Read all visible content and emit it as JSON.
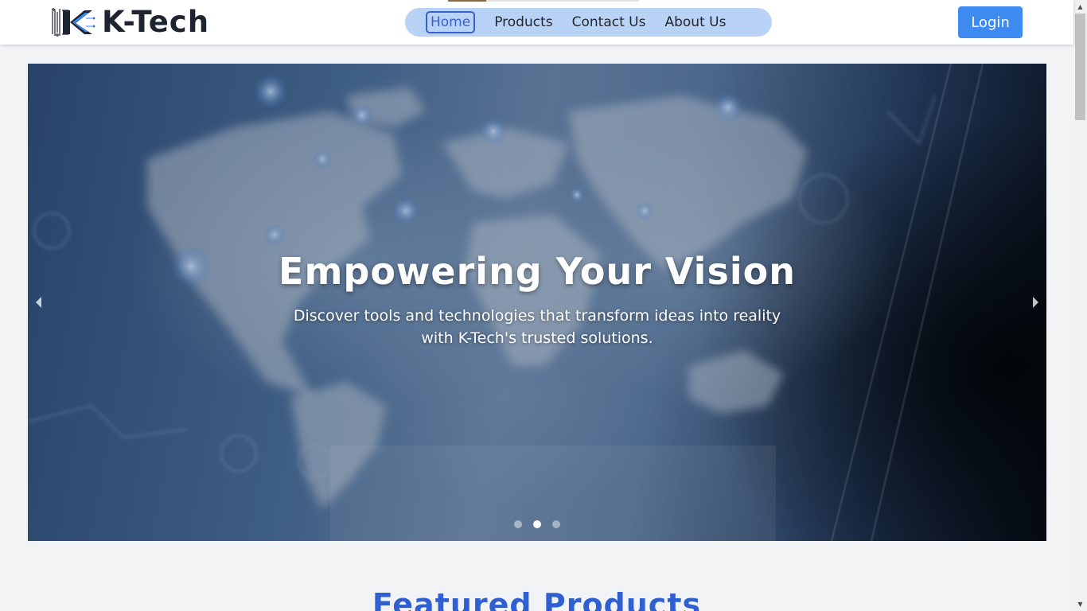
{
  "header": {
    "brand_name": "K-Tech",
    "login_label": "Login"
  },
  "nav": {
    "items": [
      {
        "label": "Home",
        "active": true
      },
      {
        "label": "Products",
        "active": false
      },
      {
        "label": "Contact Us",
        "active": false
      },
      {
        "label": "About Us",
        "active": false
      }
    ]
  },
  "hero": {
    "title": "Empowering Your Vision",
    "subtitle": "Discover tools and technologies that transform ideas into reality with K-Tech's trusted solutions.",
    "slide_count": 3,
    "active_slide": 2
  },
  "featured": {
    "title": "Featured Products"
  },
  "colors": {
    "accent": "#3d8bf0",
    "nav_pill": "#b9d3f7",
    "active_nav": "#3a61c9",
    "featured_title": "#2f5fd0"
  }
}
